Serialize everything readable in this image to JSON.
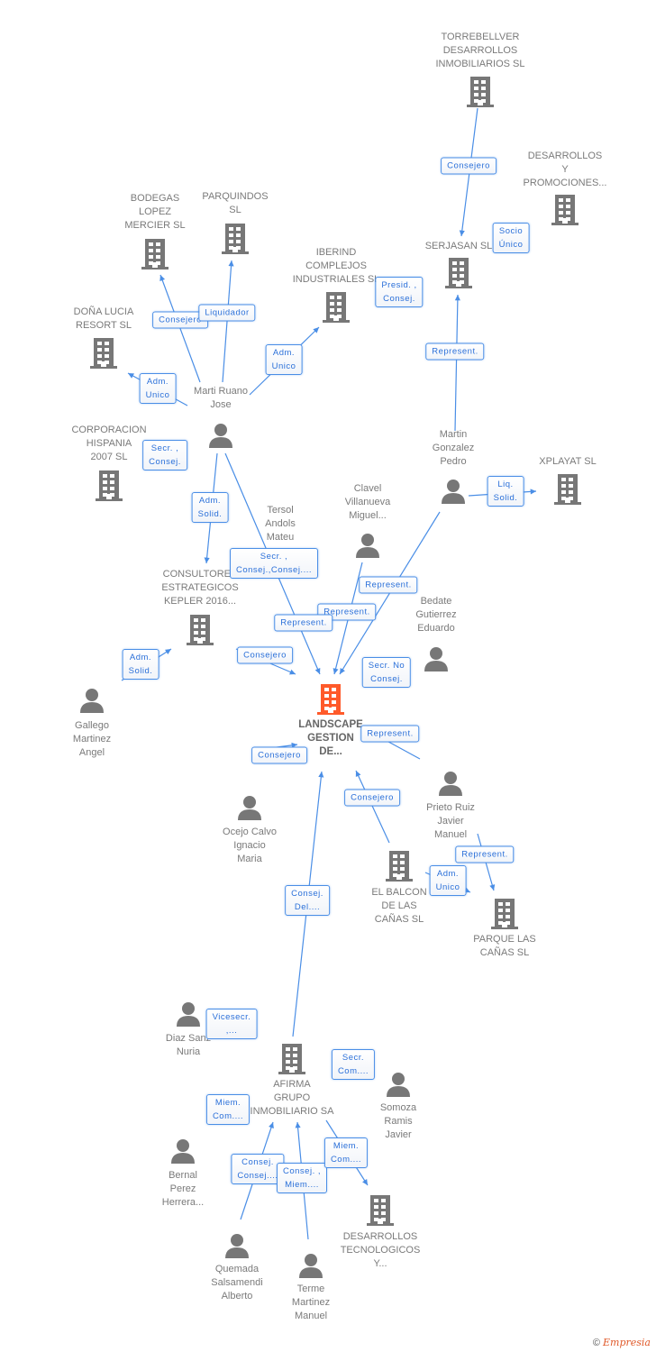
{
  "colors": {
    "edge": "#4a8ee6",
    "node": "#777777",
    "main_node": "#ff5a2a",
    "label_text": "#2b70d9"
  },
  "nodes": [
    {
      "id": "torrebellver",
      "type": "company",
      "lines": [
        "TORREBELLVER",
        "DESARROLLOS",
        "INMOBILIARIOS SL"
      ]
    },
    {
      "id": "desprom",
      "type": "company",
      "lines": [
        "DESARROLLOS",
        "Y",
        "PROMOCIONES..."
      ]
    },
    {
      "id": "serjasan",
      "type": "company",
      "lines": [
        "SERJASAN  SL"
      ]
    },
    {
      "id": "bodegas",
      "type": "company",
      "lines": [
        "BODEGAS",
        "LOPEZ",
        "MERCIER SL"
      ]
    },
    {
      "id": "parquindos",
      "type": "company",
      "lines": [
        "PARQUINDOS",
        "SL"
      ]
    },
    {
      "id": "iberind",
      "type": "company",
      "lines": [
        "IBERIND",
        "COMPLEJOS",
        "INDUSTRIALES SL"
      ]
    },
    {
      "id": "donalucia",
      "type": "company",
      "lines": [
        "DOÑA LUCIA",
        "RESORT SL"
      ]
    },
    {
      "id": "corporacion",
      "type": "company",
      "lines": [
        "CORPORACION",
        "HISPANIA",
        "2007 SL"
      ]
    },
    {
      "id": "xplayat",
      "type": "company",
      "lines": [
        "XPLAYAT SL"
      ]
    },
    {
      "id": "consultores",
      "type": "company",
      "lines": [
        "CONSULTORES",
        "ESTRATEGICOS",
        "KEPLER 2016..."
      ]
    },
    {
      "id": "landscape",
      "type": "main",
      "lines": [
        "LANDSCAPE",
        "GESTION",
        "DE..."
      ]
    },
    {
      "id": "elbalcon",
      "type": "company",
      "lines": [
        "EL BALCON",
        "DE LAS",
        "CAÑAS SL"
      ]
    },
    {
      "id": "parquecanas",
      "type": "company",
      "lines": [
        "PARQUE LAS",
        "CAÑAS SL"
      ]
    },
    {
      "id": "afirma",
      "type": "company",
      "lines": [
        "AFIRMA",
        "GRUPO",
        "INMOBILIARIO SA"
      ]
    },
    {
      "id": "destec",
      "type": "company",
      "lines": [
        "DESARROLLOS",
        "TECNOLOGICOS",
        "Y..."
      ]
    },
    {
      "id": "marti",
      "type": "person",
      "lines": [
        "Marti Ruano",
        "Jose"
      ]
    },
    {
      "id": "martin",
      "type": "person",
      "lines": [
        "Martin",
        "Gonzalez",
        "Pedro"
      ]
    },
    {
      "id": "tersol",
      "type": "person",
      "lines": [
        "Tersol",
        "Andols",
        "Mateu"
      ]
    },
    {
      "id": "clavel",
      "type": "person",
      "lines": [
        "Clavel",
        "Villanueva",
        "Miguel..."
      ]
    },
    {
      "id": "bedate",
      "type": "person",
      "lines": [
        "Bedate",
        "Gutierrez",
        "Eduardo"
      ]
    },
    {
      "id": "gallego",
      "type": "person",
      "lines": [
        "Gallego",
        "Martinez",
        "Angel"
      ]
    },
    {
      "id": "ocejo",
      "type": "person",
      "lines": [
        "Ocejo Calvo",
        "Ignacio",
        "Maria"
      ]
    },
    {
      "id": "prieto",
      "type": "person",
      "lines": [
        "Prieto Ruiz",
        "Javier",
        "Manuel"
      ]
    },
    {
      "id": "diaz",
      "type": "person",
      "lines": [
        "Diaz Sanz",
        "Nuria"
      ]
    },
    {
      "id": "somoza",
      "type": "person",
      "lines": [
        "Somoza",
        "Ramis",
        "Javier"
      ]
    },
    {
      "id": "bernal",
      "type": "person",
      "lines": [
        "Bernal",
        "Perez",
        "Herrera..."
      ]
    },
    {
      "id": "quemada",
      "type": "person",
      "lines": [
        "Quemada",
        "Salsamendi",
        "Alberto"
      ]
    },
    {
      "id": "terme",
      "type": "person",
      "lines": [
        "Terme",
        "Martinez",
        "Manuel"
      ]
    }
  ],
  "relations": [
    {
      "lines": [
        "Consejero"
      ]
    },
    {
      "lines": [
        "Socio",
        "Único"
      ]
    },
    {
      "lines": [
        "Presid. ,",
        "Consej."
      ]
    },
    {
      "lines": [
        "Represent."
      ]
    },
    {
      "lines": [
        "Consejero"
      ]
    },
    {
      "lines": [
        "Liquidador"
      ]
    },
    {
      "lines": [
        "Adm.",
        "Unico"
      ]
    },
    {
      "lines": [
        "Adm.",
        "Unico"
      ]
    },
    {
      "lines": [
        "Secr. ,",
        "Consej."
      ]
    },
    {
      "lines": [
        "Adm.",
        "Solid."
      ]
    },
    {
      "lines": [
        "Secr. ,",
        "Consej.,Consej...."
      ]
    },
    {
      "lines": [
        "Represent."
      ]
    },
    {
      "lines": [
        "Represent."
      ]
    },
    {
      "lines": [
        "Represent."
      ]
    },
    {
      "lines": [
        "Consejero"
      ]
    },
    {
      "lines": [
        "Secr.  No",
        "Consej."
      ]
    },
    {
      "lines": [
        "Liq.",
        "Solid."
      ]
    },
    {
      "lines": [
        "Adm.",
        "Solid."
      ]
    },
    {
      "lines": [
        "Represent."
      ]
    },
    {
      "lines": [
        "Consejero"
      ]
    },
    {
      "lines": [
        "Consejero"
      ]
    },
    {
      "lines": [
        "Represent."
      ]
    },
    {
      "lines": [
        "Adm.",
        "Unico"
      ]
    },
    {
      "lines": [
        "Consej.",
        "Del...."
      ]
    },
    {
      "lines": [
        "Vicesecr.",
        ",..."
      ]
    },
    {
      "lines": [
        "Secr.",
        "Com...."
      ]
    },
    {
      "lines": [
        "Miem.",
        "Com...."
      ]
    },
    {
      "lines": [
        "Consej.",
        "Consej...."
      ]
    },
    {
      "lines": [
        "Consej. ,",
        "Miem...."
      ]
    },
    {
      "lines": [
        "Miem.",
        "Com...."
      ]
    }
  ],
  "footer": {
    "copyright": "©",
    "brand": "Empresia"
  }
}
